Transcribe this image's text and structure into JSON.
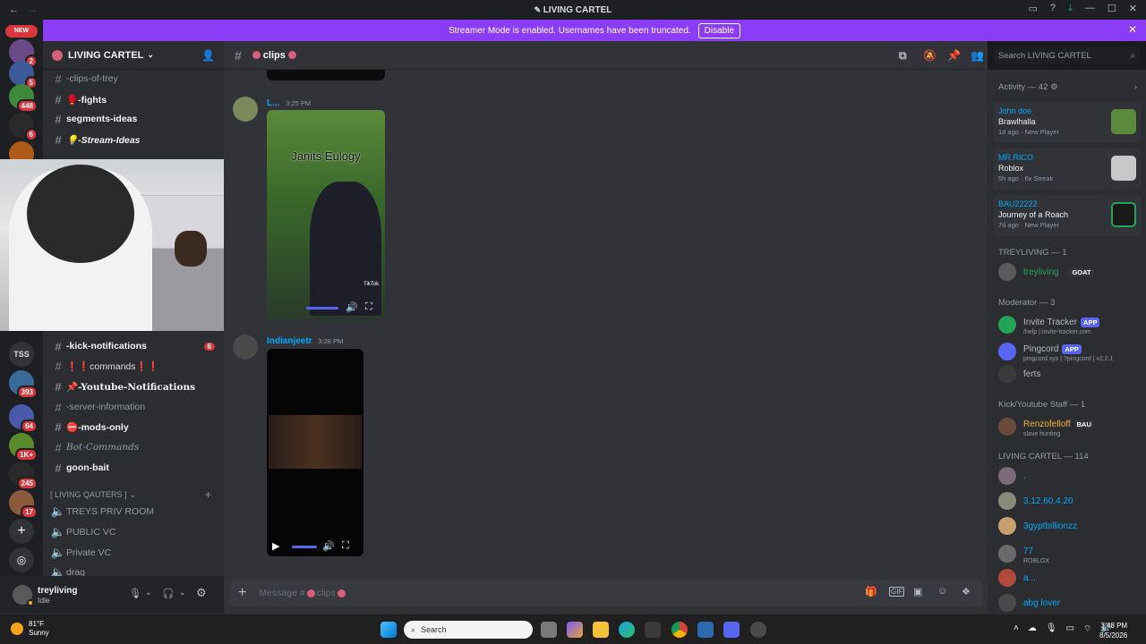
{
  "window": {
    "title": "LIVING CARTEL",
    "nav_back": "←",
    "nav_fwd": "→"
  },
  "rail": {
    "new_label": "NEW",
    "items": [
      {
        "badge": "2"
      },
      {
        "badge": "5"
      },
      {
        "badge": "448"
      },
      {
        "badge": "6"
      },
      {
        "badge": ""
      },
      {
        "label": "TSS"
      },
      {
        "badge": "393"
      },
      {
        "badge": "64"
      },
      {
        "badge": "1K+"
      },
      {
        "badge": "245"
      },
      {
        "badge": "17"
      }
    ]
  },
  "banner": {
    "text": "Streamer Mode is enabled. Usernames have been truncated.",
    "button": "Disable"
  },
  "server": {
    "name": "LIVING CARTEL"
  },
  "channels": [
    {
      "name": "-clips-of-trey",
      "style": "muted"
    },
    {
      "name": "🥊-fights",
      "style": "bold"
    },
    {
      "name": "segments-ideas",
      "style": "bold"
    },
    {
      "name": "💡-Stream-Ideas",
      "style": "bold italic"
    },
    {
      "name": "-kick-notifications",
      "style": "bold",
      "count": "6"
    },
    {
      "name": "❗❗commands❗❗",
      "style": "muted"
    },
    {
      "name": "📌-Youtube-Notifications",
      "style": "bold"
    },
    {
      "name": "-server-information",
      "style": "muted"
    },
    {
      "name": "⛔-mods-only",
      "style": "bold"
    },
    {
      "name": "Bot-Commands",
      "style": "muted italic"
    },
    {
      "name": "goon-bait",
      "style": "bold"
    }
  ],
  "voice_category": "[ LIVING QAUTERS ]",
  "voice_channels": [
    "TREYS PRIV ROOM",
    "PUBLIC VC",
    "Private VC",
    "drag"
  ],
  "user": {
    "name": "treyliving",
    "status": "Idle"
  },
  "chat": {
    "channel": "clips",
    "messages": [
      {
        "author": "L...",
        "time": "3:25 PM",
        "video_caption": "Janits Eulogy",
        "watermark": "TikTok"
      },
      {
        "author": "Indianjeetr",
        "time": "3:28 PM"
      }
    ],
    "composer_placeholder": "Message #",
    "composer_channel": "clips"
  },
  "search": {
    "placeholder": "Search LIVING CARTEL"
  },
  "members": {
    "activity_header": "Activity — 42",
    "activities": [
      {
        "user": "John doe",
        "game": "Brawlhalla",
        "meta": "1d ago",
        "tag": "New Player"
      },
      {
        "user": "MR.RICO",
        "game": "Roblox",
        "meta": "5h ago",
        "tag": "6x Streak"
      },
      {
        "user": "BAU22222",
        "game": "Journey of a Roach",
        "meta": "7d ago",
        "tag": "New Player"
      }
    ],
    "groups": [
      {
        "header": "TREYLIVING — 1",
        "members": [
          {
            "name": "treyliving",
            "badge": "GOAT",
            "color": "#23a559"
          }
        ]
      },
      {
        "header": "Moderator — 3",
        "members": [
          {
            "name": "Invite Tracker",
            "badge": "APP",
            "sub": "/help | invite-tracker.com",
            "color": "#b5bac1"
          },
          {
            "name": "Pingcord",
            "badge": "APP",
            "sub": "pingcord.xyz | ?pingcord | v2.2.1",
            "color": "#b5bac1"
          },
          {
            "name": "ferts",
            "color": "#b5bac1"
          }
        ]
      },
      {
        "header": "Kick/Youtube Staff — 1",
        "members": [
          {
            "name": "Renzofelloff",
            "badge": "BAU",
            "sub": "slave hunting",
            "color": "#f0b232"
          }
        ]
      },
      {
        "header": "LIVING CARTEL — 114",
        "members": [
          {
            "name": ".",
            "color": "#00a8fc"
          },
          {
            "name": "3.12.60.4.20",
            "color": "#00a8fc"
          },
          {
            "name": "3gyptbillionzz",
            "color": "#00a8fc"
          },
          {
            "name": "77",
            "sub": "ROBLOX",
            "color": "#00a8fc"
          },
          {
            "name": "a...",
            "color": "#00a8fc"
          },
          {
            "name": "abg lover",
            "color": "#00a8fc"
          }
        ]
      }
    ]
  },
  "taskbar": {
    "weather_temp": "81°F",
    "weather_desc": "Sunny",
    "search": "Search",
    "time": "3:48 PM",
    "date": "8/5/2026"
  },
  "colors": {
    "accent": "#8b3cf7",
    "blurple": "#5865f2",
    "danger": "#da373c",
    "online": "#23a559"
  }
}
